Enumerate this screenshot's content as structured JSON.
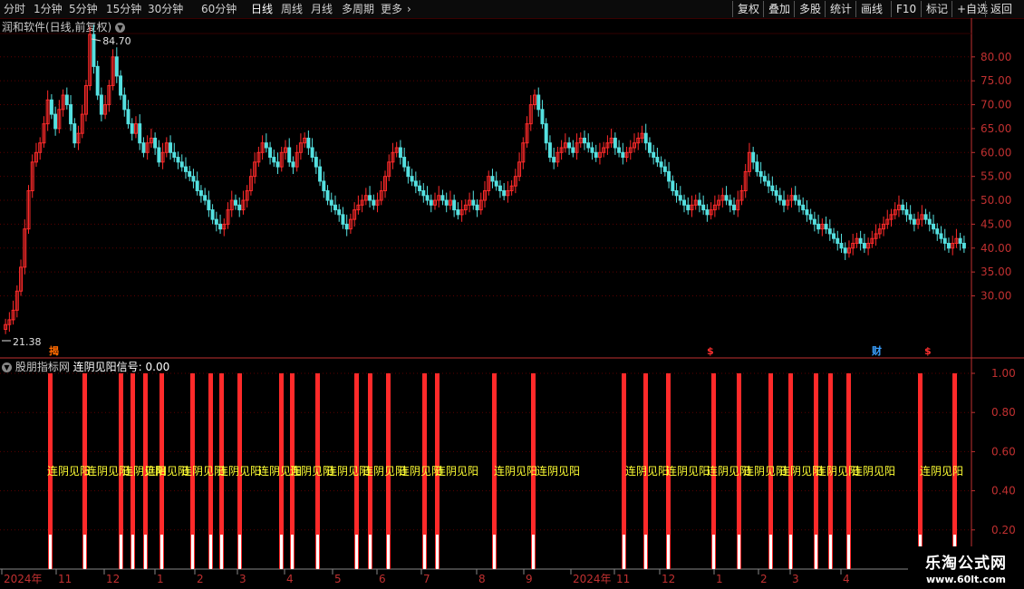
{
  "toolbar": {
    "tabs": [
      "分时",
      "1分钟",
      "5分钟",
      "15分钟",
      "30分钟",
      "60分钟",
      "日线",
      "周线",
      "月线",
      "多周期",
      "更多"
    ],
    "active_tab": "日线",
    "right_buttons": [
      "复权",
      "叠加",
      "多股",
      "统计",
      "画线",
      "F10",
      "标记",
      "+自选",
      "返回"
    ]
  },
  "main_chart": {
    "title": "润和软件(日线,前复权)",
    "high_label": "84.70",
    "low_label": "21.38",
    "y_ticks": [
      "80.00",
      "75.00",
      "70.00",
      "65.00",
      "60.00",
      "55.00",
      "50.00",
      "45.00",
      "40.00",
      "35.00",
      "30.00"
    ],
    "markers": [
      {
        "text": "揭",
        "color": "#ff6a00"
      },
      {
        "text": "$",
        "color": "#ff3030"
      },
      {
        "text": "财",
        "color": "#3aa0ff"
      },
      {
        "text": "$",
        "color": "#ff3030"
      }
    ]
  },
  "sub_chart": {
    "title": "股朋指标网",
    "signal_label": "连阴见阳信号:",
    "signal_value": "0.00",
    "signal_text": "连阴见阳",
    "y_ticks": [
      "1.00",
      "0.80",
      "0.60",
      "0.40",
      "0.20"
    ]
  },
  "x_axis": {
    "labels": [
      "2024年",
      "11",
      "12",
      "1",
      "2",
      "3",
      "4",
      "5",
      "6",
      "7",
      "8",
      "9",
      "2024年",
      "11",
      "12",
      "1",
      "2",
      "3",
      "4"
    ]
  },
  "watermark": {
    "line1": "乐淘公式网",
    "line2": "www.60lt.com"
  },
  "colors": {
    "up": "#ff2a2a",
    "down": "#55e0e0",
    "axis": "#c03030",
    "signal_text": "#ffff33"
  },
  "chart_data": {
    "type": "candlestick",
    "ylim": [
      21.38,
      84.7
    ],
    "close": [
      24,
      25,
      27,
      31,
      36,
      44,
      52,
      58,
      60,
      62,
      66,
      71,
      68,
      65,
      69,
      72,
      70,
      66,
      62,
      64,
      68,
      74,
      84.7,
      78,
      72,
      68,
      70,
      74,
      80,
      76,
      72,
      69,
      66,
      64,
      66,
      62,
      60,
      62,
      63,
      61,
      58,
      60,
      62,
      60,
      59,
      58,
      57,
      56,
      55,
      54,
      52,
      51,
      50,
      48,
      46,
      45,
      44,
      45,
      48,
      50,
      49,
      48,
      50,
      52,
      55,
      58,
      60,
      62,
      61,
      59,
      58,
      57,
      60,
      61,
      58,
      57,
      60,
      62,
      63,
      61,
      59,
      57,
      54,
      52,
      50,
      49,
      48,
      47,
      45,
      44,
      46,
      48,
      49,
      50,
      51,
      50,
      49,
      50,
      52,
      55,
      58,
      60,
      61,
      59,
      57,
      55,
      54,
      53,
      52,
      51,
      50,
      49,
      50,
      51,
      50,
      49,
      50,
      48,
      47,
      48,
      49,
      50,
      49,
      48,
      50,
      52,
      55,
      54,
      53,
      52,
      51,
      52,
      53,
      55,
      58,
      62,
      66,
      70,
      72,
      69,
      66,
      62,
      59,
      58,
      60,
      61,
      62,
      61,
      60,
      62,
      63,
      62,
      61,
      60,
      59,
      60,
      61,
      62,
      63,
      61,
      60,
      59,
      60,
      61,
      62,
      63,
      64,
      62,
      60,
      59,
      58,
      57,
      56,
      54,
      52,
      51,
      50,
      49,
      48,
      49,
      50,
      49,
      48,
      47,
      48,
      49,
      50,
      51,
      50,
      49,
      48,
      50,
      52,
      56,
      60,
      58,
      56,
      55,
      54,
      53,
      52,
      51,
      50,
      49,
      50,
      51,
      50,
      49,
      48,
      47,
      46,
      45,
      44,
      45,
      44,
      43,
      42,
      41,
      40,
      39,
      40,
      41,
      42,
      41,
      40,
      41,
      42,
      43,
      44,
      45,
      46,
      47,
      48,
      49,
      48,
      47,
      46,
      45,
      46,
      47,
      46,
      45,
      44,
      43,
      42,
      41,
      40,
      41,
      42,
      41,
      40
    ]
  }
}
